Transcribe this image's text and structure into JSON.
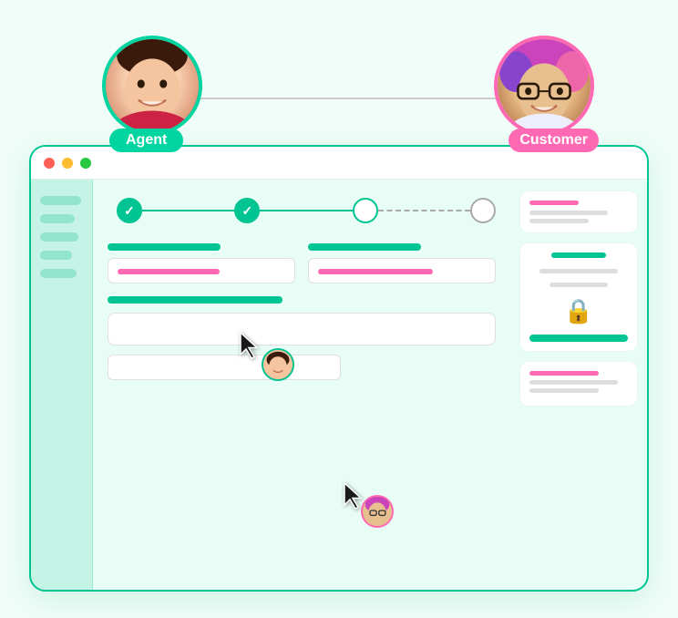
{
  "scene": {
    "agent_label": "Agent",
    "customer_label": "Customer",
    "browser": {
      "dots": [
        "red",
        "yellow",
        "green"
      ],
      "sidebar_items": 5,
      "stepper_steps": 4,
      "right_panel": {
        "card1": {
          "type": "form-preview"
        },
        "card2": {
          "type": "lock"
        },
        "card3": {
          "type": "summary"
        }
      }
    }
  }
}
